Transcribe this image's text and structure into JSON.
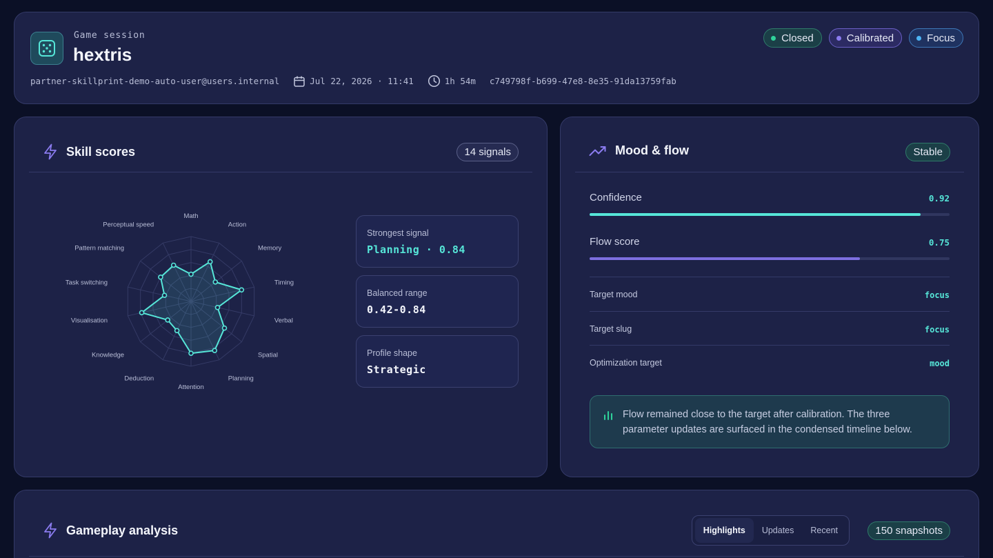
{
  "header": {
    "eyebrow": "Game session",
    "title": "hextris",
    "user": "partner-skillprint-demo-auto-user@users.internal",
    "date": "Jul 22, 2026 · 11:41",
    "duration": "1h 54m",
    "session_id": "c749798f-b699-47e8-8e35-91da13759fab",
    "icons": {
      "game": "dice-icon",
      "date": "calendar-icon",
      "duration": "clock-icon"
    },
    "badges": [
      {
        "label": "Closed",
        "color": "#2fd39a"
      },
      {
        "label": "Calibrated",
        "color": "#8b7cf0"
      },
      {
        "label": "Focus",
        "color": "#4db5f5"
      }
    ]
  },
  "skills": {
    "title": "Skill scores",
    "icon": "lightning-icon",
    "signals_badge": "14 signals",
    "chart_data": {
      "type": "radar",
      "axes": [
        "Math",
        "Action",
        "Memory",
        "Timing",
        "Verbal",
        "Spatial",
        "Planning",
        "Attention",
        "Deduction",
        "Knowledge",
        "Visualisation",
        "Task switching",
        "Pattern matching",
        "Perceptual speed"
      ],
      "values": [
        0.42,
        0.68,
        0.48,
        0.8,
        0.42,
        0.66,
        0.84,
        0.8,
        0.5,
        0.46,
        0.78,
        0.42,
        0.6,
        0.62
      ],
      "range": [
        0,
        1
      ],
      "color": "#56e6d8"
    },
    "stats": [
      {
        "label": "Strongest signal",
        "value": "Planning · 0.84"
      },
      {
        "label": "Balanced range",
        "value": "0.42-0.84"
      },
      {
        "label": "Profile shape",
        "value": "Strategic"
      }
    ]
  },
  "mood": {
    "title": "Mood & flow",
    "icon": "trending-up-icon",
    "status_badge": "Stable",
    "metrics": [
      {
        "label": "Confidence",
        "value": "0.92",
        "fraction": 0.92,
        "color": "#56e6d8"
      },
      {
        "label": "Flow score",
        "value": "0.75",
        "fraction": 0.75,
        "color": "#7d6fe0"
      }
    ],
    "rows": [
      {
        "key": "Target mood",
        "value": "focus"
      },
      {
        "key": "Target slug",
        "value": "focus"
      },
      {
        "key": "Optimization target",
        "value": "mood"
      }
    ],
    "note": "Flow remained close to the target after calibration. The three parameter updates are surfaced in the condensed timeline below.",
    "note_icon": "bar-chart-icon"
  },
  "gameplay": {
    "title": "Gameplay analysis",
    "icon": "lightning-icon",
    "tabs": [
      "Highlights",
      "Updates",
      "Recent"
    ],
    "active_tab": "Highlights",
    "snapshots_badge": "150 snapshots"
  }
}
